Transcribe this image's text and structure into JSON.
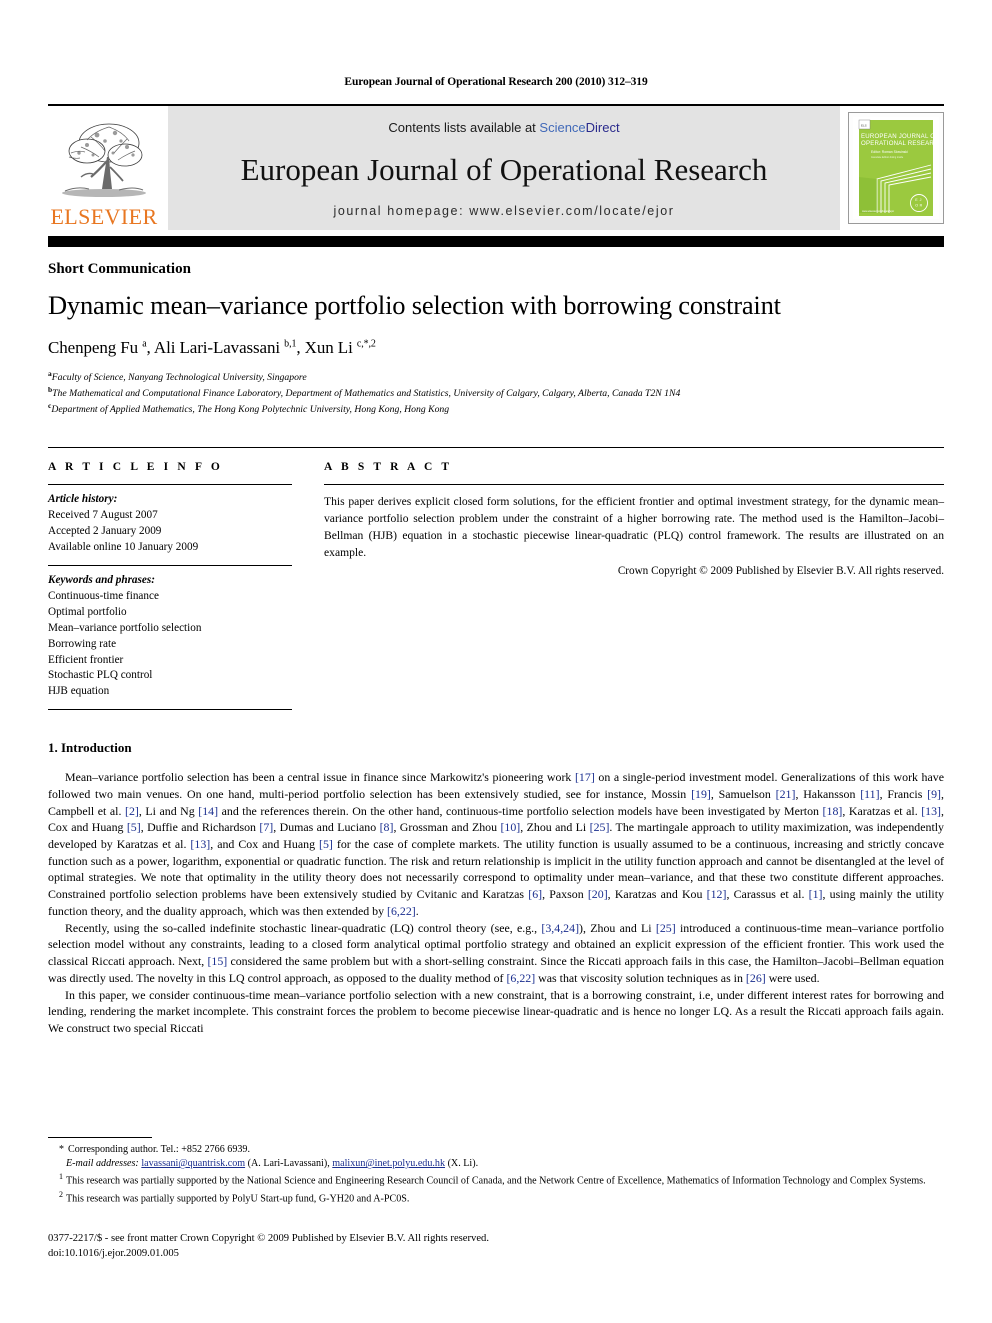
{
  "running_head": "European Journal of Operational Research 200 (2010) 312–319",
  "masthead": {
    "publisher_logo_word": "ELSEVIER",
    "contents_prefix": "Contents lists available at ",
    "sciencedirect_part1": "Science",
    "sciencedirect_part2": "Direct",
    "journal_title": "European Journal of Operational Research",
    "homepage_line": "journal homepage: www.elsevier.com/locate/ejor",
    "cover_title_line1": "EUROPEAN JOURNAL OF",
    "cover_title_line2": "OPERATIONAL RESEARCH",
    "cover_footer_url": "www.elsevier.com/locate/ejor",
    "cover_logo_text": "EJOR",
    "colors": {
      "elsevier_orange": "#E87722",
      "sciencedirect_blue": "#4169b8",
      "sciencedirect_navy": "#2a2a8c",
      "band_gray": "#e3e3e3",
      "cover_green": "#8cc63e",
      "citation_blue": "#1b2f8f"
    }
  },
  "article": {
    "section_type": "Short Communication",
    "title": "Dynamic mean–variance portfolio selection with borrowing constraint",
    "authors_html": "Chenpeng Fu <sup>a</sup>, Ali Lari-Lavassani <sup>b,1</sup>, Xun Li <sup>c,*,2</sup>",
    "affiliations": [
      {
        "marker": "a",
        "text": "Faculty of Science, Nanyang Technological University, Singapore"
      },
      {
        "marker": "b",
        "text": "The Mathematical and Computational Finance Laboratory, Department of Mathematics and Statistics, University of Calgary, Calgary, Alberta, Canada T2N 1N4"
      },
      {
        "marker": "c",
        "text": "Department of Applied Mathematics, The Hong Kong Polytechnic University, Hong Kong, Hong Kong"
      }
    ]
  },
  "article_info": {
    "heading": "A R T I C L E    I N F O",
    "history_label": "Article history:",
    "history": [
      "Received 7 August 2007",
      "Accepted 2 January 2009",
      "Available online 10 January 2009"
    ],
    "keywords_label": "Keywords and phrases:",
    "keywords": [
      "Continuous-time finance",
      "Optimal portfolio",
      "Mean–variance portfolio selection",
      "Borrowing rate",
      "Efficient frontier",
      "Stochastic PLQ control",
      "HJB equation"
    ]
  },
  "abstract": {
    "heading": "A B S T R A C T",
    "text": "This paper derives explicit closed form solutions, for the efficient frontier and optimal investment strategy, for the dynamic mean–variance portfolio selection problem under the constraint of a higher borrowing rate. The method used is the Hamilton–Jacobi–Bellman (HJB) equation in a stochastic piecewise linear-quadratic (PLQ) control framework. The results are illustrated on an example.",
    "copyright": "Crown Copyright © 2009 Published by Elsevier B.V. All rights reserved."
  },
  "body": {
    "section_heading": "1. Introduction",
    "paragraphs": [
      "Mean–variance portfolio selection has been a central issue in finance since Markowitz's pioneering work [17] on a single-period investment model. Generalizations of this work have followed two main venues. On one hand, multi-period portfolio selection has been extensively studied, see for instance, Mossin [19], Samuelson [21], Hakansson [11], Francis [9], Campbell et al. [2], Li and Ng [14] and the references therein. On the other hand, continuous-time portfolio selection models have been investigated by Merton [18], Karatzas et al. [13], Cox and Huang [5], Duffie and Richardson [7], Dumas and Luciano [8], Grossman and Zhou [10], Zhou and Li [25]. The martingale approach to utility maximization, was independently developed by Karatzas et al. [13], and Cox and Huang [5] for the case of complete markets. The utility function is usually assumed to be a continuous, increasing and strictly concave function such as a power, logarithm, exponential or quadratic function. The risk and return relationship is implicit in the utility function approach and cannot be disentangled at the level of optimal strategies. We note that optimality in the utility theory does not necessarily correspond to optimality under mean–variance, and that these two constitute different approaches. Constrained portfolio selection problems have been extensively studied by Cvitanic and Karatzas [6], Paxson [20], Karatzas and Kou [12], Carassus et al. [1], using mainly the utility function theory, and the duality approach, which was then extended by [6,22].",
      "Recently, using the so-called indefinite stochastic linear-quadratic (LQ) control theory (see, e.g., [3,4,24]), Zhou and Li [25] introduced a continuous-time mean–variance portfolio selection model without any constraints, leading to a closed form analytical optimal portfolio strategy and obtained an explicit expression of the efficient frontier. This work used the classical Riccati approach. Next, [15] considered the same problem but with a short-selling constraint. Since the Riccati approach fails in this case, the Hamilton–Jacobi–Bellman equation was directly used. The novelty in this LQ control approach, as opposed to the duality method of [6,22] was that viscosity solution techniques as in [26] were used.",
      "In this paper, we consider continuous-time mean–variance portfolio selection with a new constraint, that is a borrowing constraint, i.e, under different interest rates for borrowing and lending, rendering the market incomplete. This constraint forces the problem to become piecewise linear-quadratic and is hence no longer LQ. As a result the Riccati approach fails again. We construct two special Riccati"
    ]
  },
  "footnotes": {
    "corresponding": "Corresponding author. Tel.: +852 2766 6939.",
    "emails_label": "E-mail addresses:",
    "email_1": "lavassani@quantrisk.com",
    "email_1_owner": "(A. Lari-Lavassani),",
    "email_2": "malixun@inet.polyu.edu.hk",
    "email_2_owner": "(X. Li).",
    "note_1_marker": "1",
    "note_1": "This research was partially supported by the National Science and Engineering Research Council of Canada, and the Network Centre of Excellence, Mathematics of Information Technology and Complex Systems.",
    "note_2_marker": "2",
    "note_2": "This research was partially supported by PolyU Start-up fund, G-YH20 and A-PC0S."
  },
  "footer": {
    "issn_line": "0377-2217/$ - see front matter Crown Copyright © 2009 Published by Elsevier B.V. All rights reserved.",
    "doi_line": "doi:10.1016/j.ejor.2009.01.005"
  }
}
